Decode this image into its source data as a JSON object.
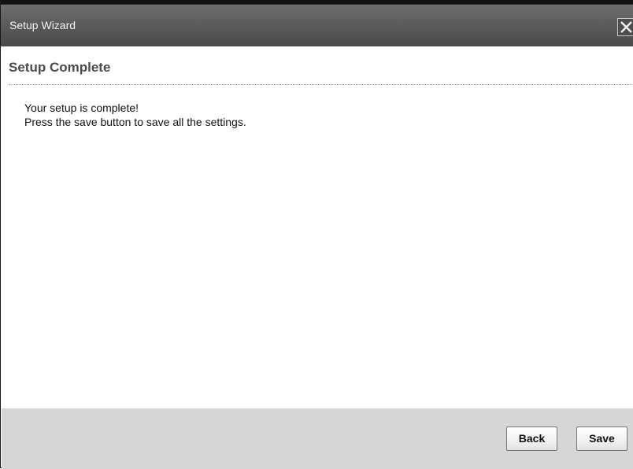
{
  "window": {
    "title": "Setup Wizard",
    "close_icon": "close-icon"
  },
  "section": {
    "title": "Setup Complete"
  },
  "message": {
    "line1": "Your setup is complete!",
    "line2": "Press the save button to save all the settings."
  },
  "footer": {
    "back_label": "Back",
    "save_label": "Save"
  }
}
